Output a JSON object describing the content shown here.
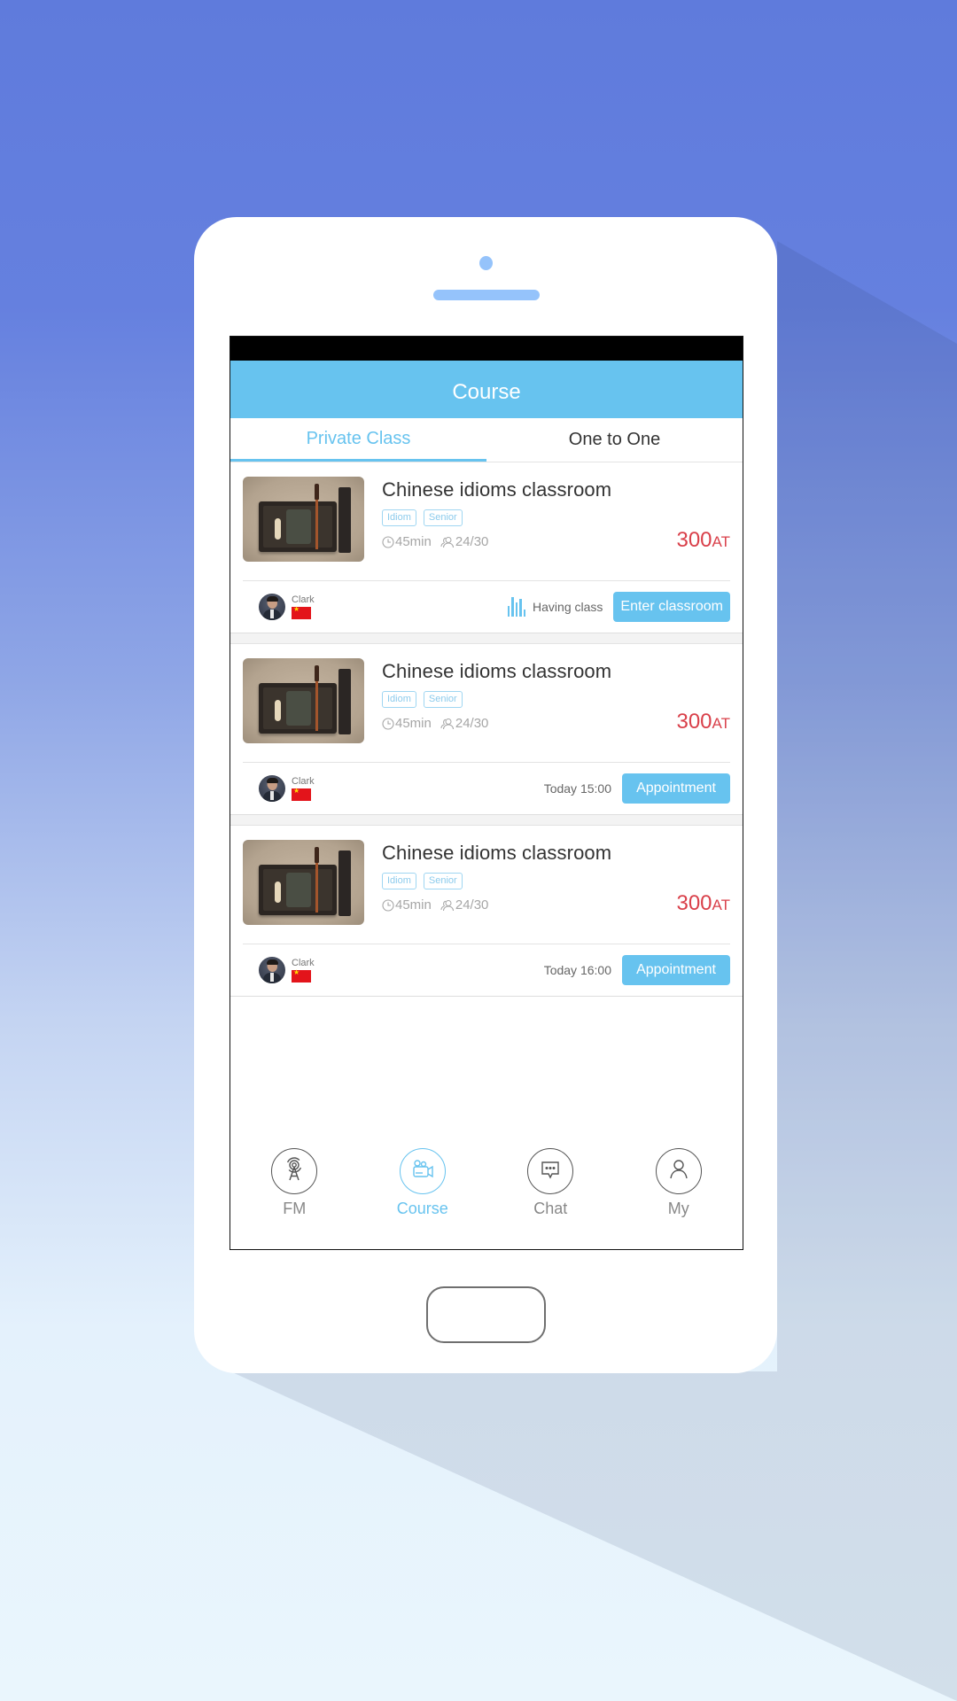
{
  "theme": {
    "accent": "#67c3ef",
    "price_color": "#d9404a",
    "background_top": "#5f7bdc",
    "background_bottom": "#eaf6fd"
  },
  "appbar": {
    "title": "Course"
  },
  "tabs": [
    {
      "label": "Private Class",
      "active": true
    },
    {
      "label": "One to One",
      "active": false
    }
  ],
  "courses": [
    {
      "title": "Chinese idioms classroom",
      "tags": [
        "Idiom",
        "Senior"
      ],
      "duration": "45min",
      "enrolled": "24/30",
      "price": "300",
      "currency": "AT",
      "teacher": "Clark",
      "teacher_flag": "china-flag",
      "status_text": "Having class",
      "action_label": "Enter classroom"
    },
    {
      "title": "Chinese idioms classroom",
      "tags": [
        "Idiom",
        "Senior"
      ],
      "duration": "45min",
      "enrolled": "24/30",
      "price": "300",
      "currency": "AT",
      "teacher": "Clark",
      "teacher_flag": "china-flag",
      "schedule": "Today 15:00",
      "action_label": "Appointment"
    },
    {
      "title": "Chinese idioms classroom",
      "tags": [
        "Idiom",
        "Senior"
      ],
      "duration": "45min",
      "enrolled": "24/30",
      "price": "300",
      "currency": "AT",
      "teacher": "Clark",
      "teacher_flag": "china-flag",
      "schedule": "Today 16:00",
      "action_label": "Appointment"
    }
  ],
  "tabbar": [
    {
      "label": "FM",
      "icon": "radio-tower-icon",
      "active": false
    },
    {
      "label": "Course",
      "icon": "video-camera-icon",
      "active": true
    },
    {
      "label": "Chat",
      "icon": "chat-bubble-icon",
      "active": false
    },
    {
      "label": "My",
      "icon": "user-icon",
      "active": false
    }
  ]
}
